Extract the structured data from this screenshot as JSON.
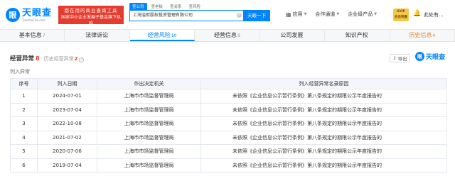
{
  "header": {
    "logo_cn": "天眼查",
    "logo_en": "TianYanCha.com",
    "slogan_line1": "都在用的商业查询工具",
    "slogan_line2": "国家中小企业发展子基金旗下机构",
    "search_tabs": [
      "查公司",
      "查老板",
      "查关系",
      "查风险"
    ],
    "search_value": "上海溢熙股权投资管理有限公司",
    "search_button": "天眼一下",
    "nav": [
      {
        "icon": "grid-icon",
        "label": "应用"
      },
      {
        "icon": "",
        "label": "合作通道"
      },
      {
        "icon": "",
        "label": "企业级产品"
      }
    ],
    "vip_line1": "SVIP",
    "vip_line2": "会员特惠",
    "user_name": "此处有..."
  },
  "module_tabs": [
    {
      "label": "基本信息",
      "count": "7"
    },
    {
      "label": "法律诉讼",
      "count": ""
    },
    {
      "label": "经营风险",
      "count": "10"
    },
    {
      "label": "经营信息",
      "count": "9"
    },
    {
      "label": "公司发展",
      "count": ""
    },
    {
      "label": "知识产权",
      "count": ""
    },
    {
      "label": "历史信息",
      "count": "4"
    }
  ],
  "section": {
    "title": "经营异常",
    "count": "8",
    "history_label": "历史经营异常",
    "history_count": "2",
    "export_label": "导出",
    "watermark": "天眼查",
    "subtitle": "列入异常"
  },
  "table": {
    "headers": [
      "序号",
      "列入日期",
      "作出决定机关",
      "列入经营异常名录原因"
    ],
    "rows": [
      [
        "1",
        "2024-07-01",
        "上海市市场监督管理局",
        "未依照《企业信息公示暂行条例》第八条规定的期限公示年度报告的"
      ],
      [
        "2",
        "2023-07-04",
        "上海市市场监督管理局",
        "未依照《企业信息公示暂行条例》第八条规定的期限公示年度报告的"
      ],
      [
        "3",
        "2022-10-08",
        "上海市市场监督管理局",
        "未依照《企业信息公示暂行条例》第八条规定的期限公示年度报告的"
      ],
      [
        "4",
        "2021-07-02",
        "上海市市场监督管理局",
        "未依照《企业信息公示暂行条例》第八条规定的期限公示年度报告的"
      ],
      [
        "5",
        "2020-07-06",
        "上海市市场监督管理局",
        "未依照《企业信息公示暂行条例》第八条规定的期限公示年度报告的"
      ],
      [
        "6",
        "2019-07-04",
        "上海市市场监督管理局",
        "未依照《企业信息公示暂行条例》第八条规定的期限公示年度报告的"
      ]
    ]
  }
}
